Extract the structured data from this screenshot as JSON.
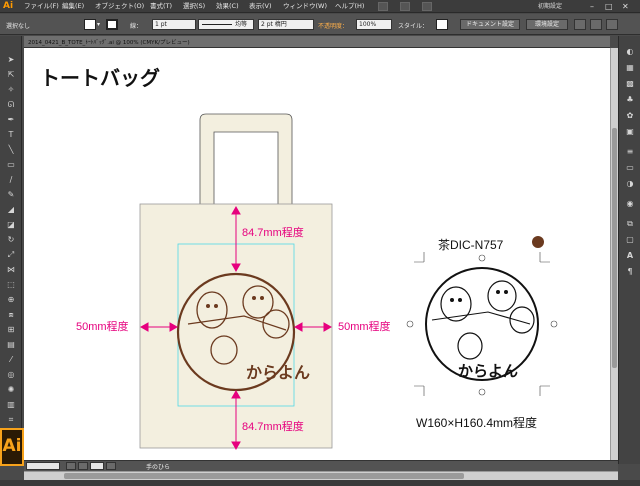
{
  "app": {
    "logo": "Ai",
    "menu": [
      "ファイル(F)",
      "編集(E)",
      "オブジェクト(O)",
      "書式(T)",
      "選択(S)",
      "効果(C)",
      "表示(V)",
      "ウィンドウ(W)",
      "ヘルプ(H)"
    ],
    "workspace": "初期設定"
  },
  "control_bar": {
    "selection_state": "選択なし",
    "stroke_label": "線：",
    "stroke_weight": "1 pt",
    "stroke_style": "均等",
    "brush": "2 pt 楕円",
    "opacity_label": "不透明度：",
    "opacity_value": "100%",
    "style_label": "スタイル：",
    "document_setup": "ドキュメント設定",
    "preferences": "環境設定"
  },
  "document_tab": {
    "title": "2014_0421_B_TOTE_ﾄｰﾄﾊﾞｯｸﾞ.ai @ 100% (CMYK/プレビュー)"
  },
  "artboard": {
    "title": "トートバッグ",
    "dim_top": "84.7mm程度",
    "dim_bottom": "84.7mm程度",
    "dim_left": "50mm程度",
    "dim_right": "50mm程度",
    "color_spec": "茶DIC-N757",
    "size_spec": "W160×H160.4mm程度",
    "logo_text": "からよん",
    "bag_color": "#f3efdf",
    "ink_color": "#6b3a1f",
    "guide_color": "#e6007e"
  },
  "status_bar": {
    "tool_name": "手のひら"
  },
  "badge": {
    "label": "Ai"
  }
}
